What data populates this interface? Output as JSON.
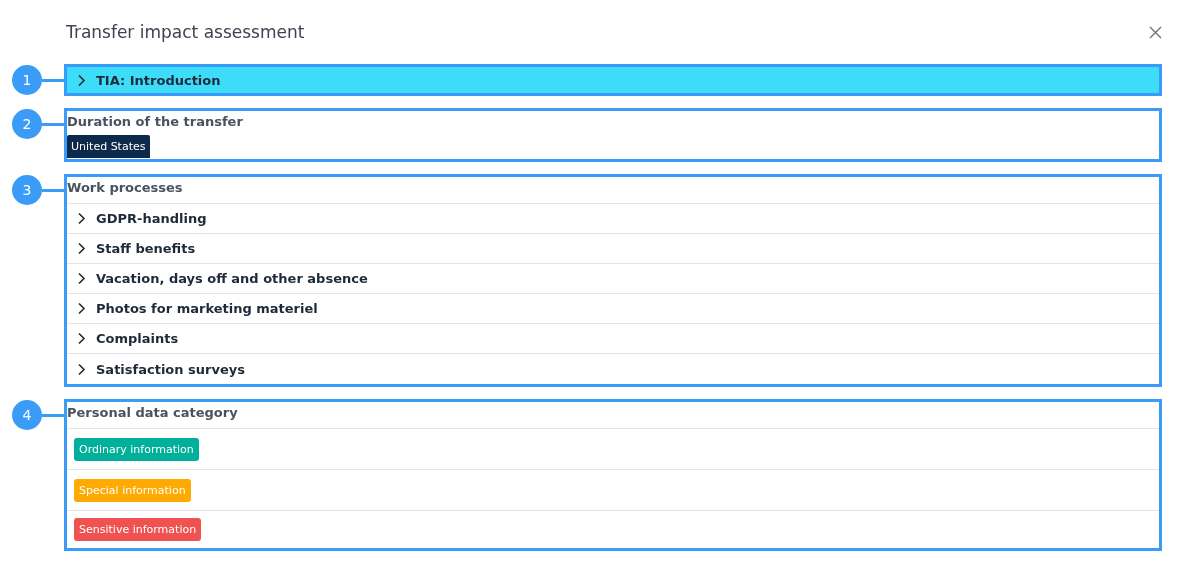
{
  "dialog": {
    "title": "Transfer impact assessment"
  },
  "sections": [
    {
      "kind": "header",
      "marker": "1",
      "label": "TIA: Introduction",
      "expanded": false
    },
    {
      "kind": "tags",
      "marker": "2",
      "heading": "Duration of the transfer",
      "tags": [
        {
          "label": "United States",
          "color": "#0d2a4a"
        }
      ]
    },
    {
      "kind": "list",
      "marker": "3",
      "heading": "Work processes",
      "items": [
        {
          "label": "GDPR-handling",
          "expanded": false
        },
        {
          "label": "Staff benefits",
          "expanded": false
        },
        {
          "label": "Vacation, days off and other absence",
          "expanded": false
        },
        {
          "label": "Photos for marketing materiel",
          "expanded": false
        },
        {
          "label": "Complaints",
          "expanded": false
        },
        {
          "label": "Satisfaction surveys",
          "expanded": false
        }
      ]
    },
    {
      "kind": "tag-rows",
      "marker": "4",
      "heading": "Personal data category",
      "tags": [
        {
          "label": "Ordinary information",
          "color": "#00b09b"
        },
        {
          "label": "Special information",
          "color": "#ffaa00"
        },
        {
          "label": "Sensitive information",
          "color": "#f05252"
        }
      ]
    }
  ]
}
